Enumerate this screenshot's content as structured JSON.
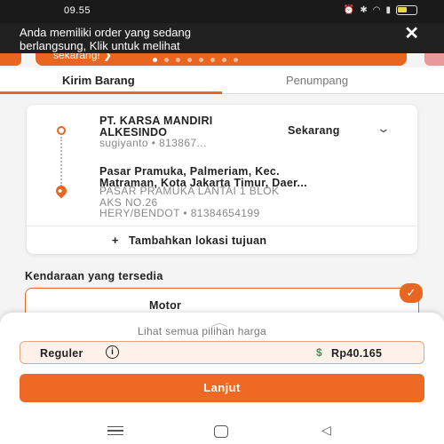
{
  "status_bar": {
    "time": "09.55"
  },
  "banner": {
    "line1": "Anda memiliki order yang sedang",
    "line2": "berlangsung, Klik untuk melihat",
    "close_icon": "✕"
  },
  "carousel": {
    "text": "sekarang! ❯",
    "active_dot": 0,
    "dot_count": 8
  },
  "tabs": {
    "active": "Kirim Barang",
    "inactive": "Penumpang"
  },
  "route": {
    "origin": {
      "name_line1": "PT. KARSA MANDIRI",
      "name_line2": "ALKESINDO",
      "contact": "sugiyanto • 813867..."
    },
    "schedule": "Sekarang",
    "destination": {
      "line1": "Pasar Pramuka, Palmeriam, Kec.",
      "line2": "Matraman, Kota Jakarta Timur, Daer...",
      "detail_line1": "PASAR PRAMUKA LANTAI 1 BLOK",
      "detail_line2": "AKS NO.26",
      "contact": "HERY/BENDOT • 81384654199"
    },
    "add_destination": "Tambahkan lokasi tujuan"
  },
  "vehicles": {
    "title": "Kendaraan yang tersedia",
    "selected": "Motor"
  },
  "sheet": {
    "see_all": "Lihat semua pilihan harga",
    "price_option": "Reguler",
    "price": "Rp40.165",
    "next_button": "Lanjut"
  },
  "colors": {
    "accent": "#ee6a24",
    "banner_bg": "#212121",
    "price_bg": "#fdf1ea"
  }
}
